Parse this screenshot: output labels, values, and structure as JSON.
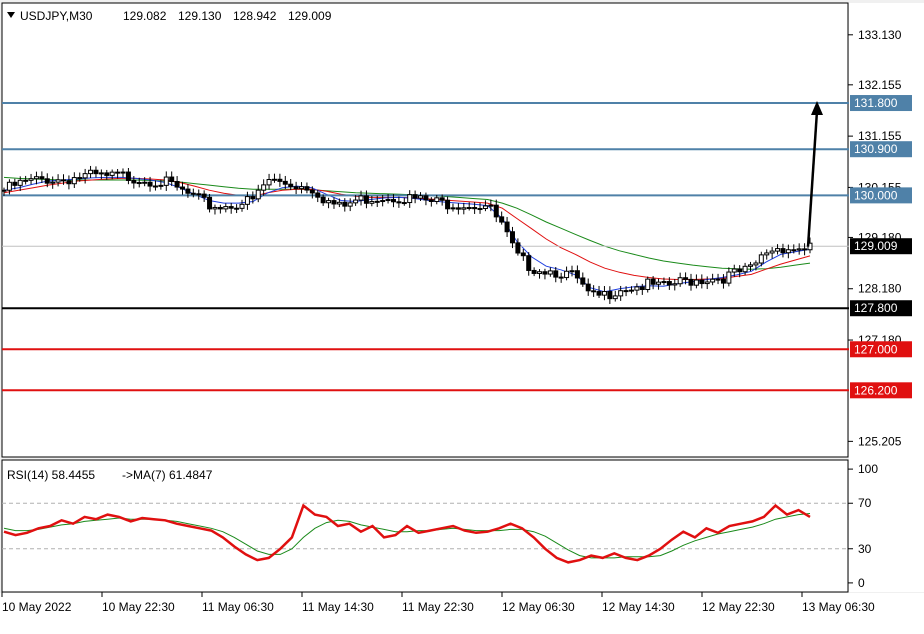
{
  "header": {
    "symbol": "USDJPY,M30",
    "open": "129.082",
    "high": "129.130",
    "low": "128.942",
    "close": "129.009"
  },
  "rsi_header": {
    "label": "RSI(14) 58.4455",
    "ma_label": "->MA(7) 61.4847"
  },
  "colors": {
    "up_line": "#4f81a8",
    "support_black": "#000000",
    "support_red": "#e01010",
    "ma_fast": "#1f3fe0",
    "ma_mid": "#e01010",
    "ma_slow": "#1a8a1a",
    "rsi": "#e01010",
    "rsi_ma": "#1a8a1a",
    "current": "#000000"
  },
  "chart_data": [
    {
      "type": "candlestick",
      "title": "USDJPY,M30",
      "ylim": [
        124.9,
        133.75
      ],
      "y_ticks": [
        "133.130",
        "132.155",
        "131.155",
        "130.155",
        "129.180",
        "128.180",
        "127.180",
        "125.205"
      ],
      "x_ticks": [
        "10 May 2022",
        "10 May 22:30",
        "11 May 06:30",
        "11 May 14:30",
        "11 May 22:30",
        "12 May 06:30",
        "12 May 14:30",
        "12 May 22:30",
        "13 May 06:30"
      ],
      "levels": [
        {
          "value": 131.8,
          "label": "131.800",
          "color": "#4f81a8"
        },
        {
          "value": 130.9,
          "label": "130.900",
          "color": "#4f81a8"
        },
        {
          "value": 130.0,
          "label": "130.000",
          "color": "#4f81a8"
        },
        {
          "value": 127.8,
          "label": "127.800",
          "color": "#000000"
        },
        {
          "value": 127.0,
          "label": "127.000",
          "color": "#e01010"
        },
        {
          "value": 126.2,
          "label": "126.200",
          "color": "#e01010"
        }
      ],
      "current_price": {
        "value": 129.009,
        "label": "129.009"
      },
      "arrow": {
        "from": 129.0,
        "to": 131.8
      },
      "close_path": [
        130.1,
        130.22,
        130.28,
        130.32,
        130.3,
        130.36,
        130.38,
        130.35,
        130.38,
        130.34,
        130.3,
        130.25,
        130.1,
        129.95,
        129.8,
        129.78,
        129.85,
        129.9,
        130.3,
        130.25,
        130.2,
        130.15,
        129.9,
        129.75,
        129.9,
        129.95,
        129.98,
        129.97,
        129.93,
        129.88,
        129.85,
        129.84,
        129.82,
        129.8,
        129.4,
        128.8,
        128.6,
        128.55,
        128.5,
        128.4,
        128.0,
        128.05,
        128.2,
        128.22,
        128.25,
        128.2,
        128.3,
        128.35,
        128.38,
        128.4,
        128.48,
        128.55,
        128.9,
        129.0,
        128.95,
        129.01
      ],
      "ma_fast_path": [
        130.1,
        130.15,
        130.22,
        130.28,
        130.3,
        130.32,
        130.34,
        130.35,
        130.35,
        130.33,
        130.3,
        130.25,
        130.15,
        130.02,
        129.9,
        129.85,
        129.85,
        129.88,
        130.05,
        130.15,
        130.18,
        130.15,
        130.02,
        129.9,
        129.88,
        129.92,
        129.95,
        129.96,
        129.94,
        129.9,
        129.87,
        129.85,
        129.83,
        129.8,
        129.55,
        129.1,
        128.8,
        128.62,
        128.55,
        128.45,
        128.2,
        128.12,
        128.18,
        128.22,
        128.24,
        128.23,
        128.28,
        128.32,
        128.36,
        128.4,
        128.45,
        128.52,
        128.7,
        128.85,
        128.9,
        128.95
      ],
      "ma_mid_path": [
        130.05,
        130.1,
        130.15,
        130.2,
        130.24,
        130.28,
        130.3,
        130.32,
        130.33,
        130.33,
        130.32,
        130.3,
        130.25,
        130.18,
        130.1,
        130.04,
        130.0,
        129.98,
        130.05,
        130.1,
        130.12,
        130.12,
        130.08,
        130.02,
        129.98,
        129.96,
        129.96,
        129.96,
        129.95,
        129.93,
        129.91,
        129.89,
        129.87,
        129.85,
        129.75,
        129.55,
        129.35,
        129.15,
        128.98,
        128.85,
        128.7,
        128.58,
        128.5,
        128.44,
        128.4,
        128.37,
        128.36,
        128.36,
        128.37,
        128.38,
        128.42,
        128.46,
        128.56,
        128.66,
        128.74,
        128.82
      ],
      "ma_slow_path": [
        130.35,
        130.33,
        130.32,
        130.31,
        130.3,
        130.3,
        130.3,
        130.3,
        130.3,
        130.3,
        130.29,
        130.28,
        130.26,
        130.23,
        130.2,
        130.17,
        130.14,
        130.12,
        130.12,
        130.12,
        130.12,
        130.11,
        130.09,
        130.07,
        130.05,
        130.04,
        130.03,
        130.02,
        130.01,
        130.0,
        129.98,
        129.96,
        129.94,
        129.92,
        129.85,
        129.75,
        129.62,
        129.48,
        129.36,
        129.24,
        129.12,
        129.01,
        128.92,
        128.85,
        128.78,
        128.72,
        128.68,
        128.64,
        128.61,
        128.58,
        128.57,
        128.56,
        128.57,
        128.6,
        128.64,
        128.68
      ]
    },
    {
      "type": "line",
      "title": "RSI(14) 58.4455",
      "ylim": [
        -8,
        108
      ],
      "y_ticks": [
        "100",
        "70",
        "30",
        "0"
      ],
      "dashed_levels": [
        70,
        30
      ],
      "series": [
        {
          "name": "RSI(14)",
          "values": [
            45,
            42,
            44,
            48,
            50,
            55,
            52,
            58,
            56,
            60,
            58,
            54,
            57,
            56,
            55,
            52,
            50,
            48,
            46,
            40,
            32,
            25,
            20,
            22,
            30,
            40,
            68,
            60,
            58,
            50,
            52,
            45,
            50,
            40,
            42,
            50,
            44,
            46,
            48,
            50,
            46,
            44,
            45,
            48,
            52,
            48,
            40,
            30,
            22,
            18,
            20,
            24,
            22,
            26,
            22,
            20,
            24,
            30,
            38,
            45,
            40,
            48,
            44,
            50,
            52,
            54,
            58,
            68,
            60,
            64,
            58
          ]
        },
        {
          "name": "->MA(7)",
          "values": [
            48,
            46,
            46,
            47,
            49,
            51,
            52,
            54,
            55,
            56,
            57,
            56,
            56,
            56,
            55,
            54,
            52,
            50,
            48,
            45,
            40,
            34,
            28,
            25,
            25,
            30,
            40,
            48,
            53,
            55,
            54,
            51,
            49,
            47,
            45,
            45,
            46,
            46,
            47,
            48,
            47,
            46,
            46,
            46,
            47,
            47,
            45,
            41,
            35,
            29,
            24,
            22,
            22,
            22,
            23,
            23,
            23,
            24,
            28,
            33,
            37,
            40,
            43,
            45,
            47,
            49,
            52,
            56,
            58,
            60,
            61
          ]
        }
      ]
    }
  ]
}
